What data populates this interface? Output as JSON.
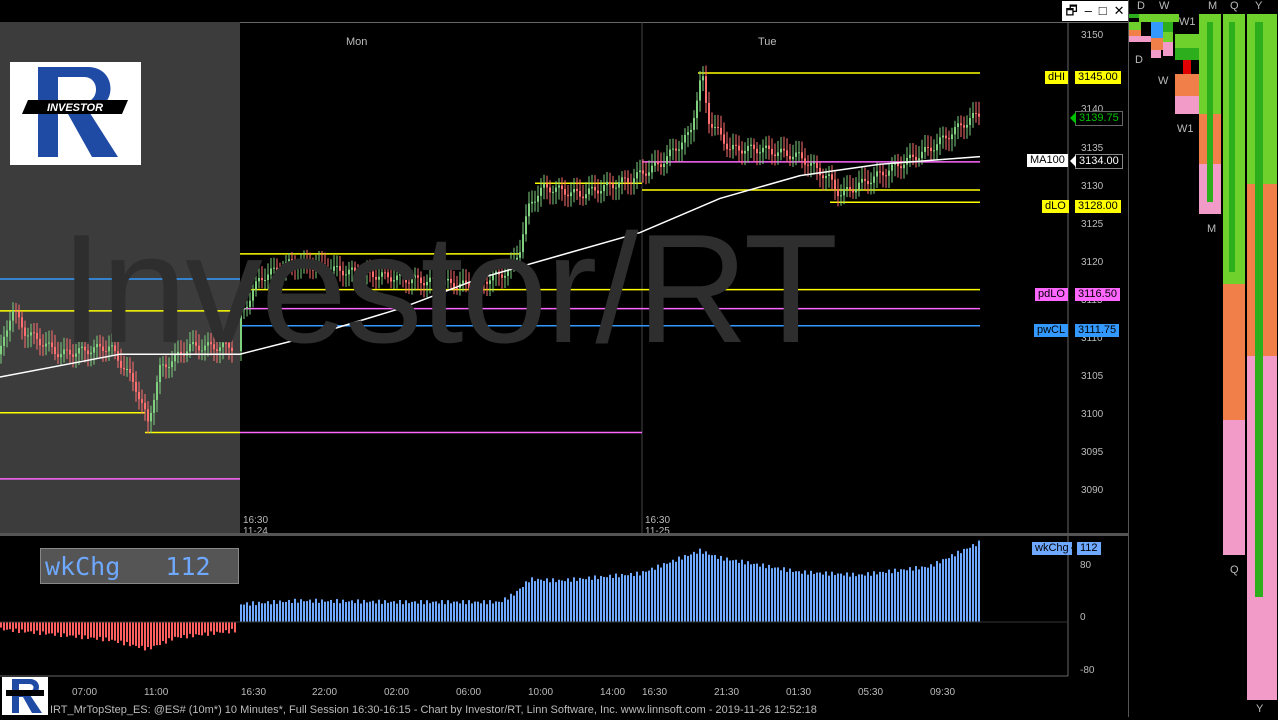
{
  "window": {
    "restore_glyph": "🗗",
    "minimize_glyph": "‒",
    "maximize_glyph": "□",
    "close_glyph": "✕"
  },
  "logo_text": "INVESTOR",
  "watermark": "Investor/RT",
  "day_labels": [
    "Mon",
    "Tue"
  ],
  "session_starts": [
    {
      "time": "16:30",
      "date": "11-24"
    },
    {
      "time": "16:30",
      "date": "11-25"
    }
  ],
  "price_axis": [
    "3150",
    "3145",
    "3140",
    "3135",
    "3130",
    "3125",
    "3120",
    "3115",
    "3110",
    "3105",
    "3100",
    "3095",
    "3090"
  ],
  "level_tags": [
    {
      "name": "dHI",
      "value": "3145.00",
      "color": "#ffff00"
    },
    {
      "name": "",
      "value": "3139.75",
      "color": "#00c000"
    },
    {
      "name": "MA100",
      "value": "3134.00",
      "color": "#ffffff"
    },
    {
      "name": "dLO",
      "value": "3128.00",
      "color": "#ffff00"
    },
    {
      "name": "pdLO",
      "value": "3116.50",
      "color": "#ff66ff"
    },
    {
      "name": "pwCL",
      "value": "3111.75",
      "color": "#3399ff"
    }
  ],
  "indicator": {
    "name": "wkChg",
    "value": "112",
    "axis": [
      "80",
      "0",
      "-80"
    ]
  },
  "time_axis": [
    "07:00",
    "11:00",
    "16:30",
    "22:00",
    "02:00",
    "06:00",
    "10:00",
    "14:00",
    "16:30",
    "21:30",
    "01:30",
    "05:30",
    "09:30"
  ],
  "status_bar": "IRT_MrTopStep_ES: @ES# (10m*) 10 Minutes*, Full Session 16:30-16:15 - Chart by Investor/RT, Linn Software, Inc. www.linnsoft.com - 2019-11-26 12:52:18",
  "tpo_header": [
    "D",
    "W",
    "M",
    "Q",
    "Y"
  ],
  "tpo_labels": [
    "W1",
    "D",
    "W",
    "W1",
    "M",
    "Q",
    "Y"
  ],
  "colors": {
    "yellow": "#ffff00",
    "magenta": "#ff66ff",
    "blue": "#3399ff",
    "ma": "#ffffff",
    "up": "#7fd17f",
    "down": "#ff6f6f",
    "green": "#2cae1d",
    "pink": "#f29ac8",
    "orange": "#f17f4a",
    "lightgreen": "#6fd12c"
  }
}
